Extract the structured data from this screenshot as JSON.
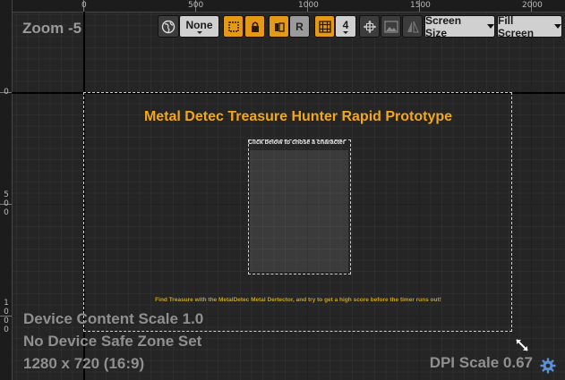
{
  "zoom_label": "Zoom -5",
  "ruler": {
    "top_labels": [
      "0",
      "500",
      "1000",
      "1500",
      "2000"
    ],
    "left_labels": [
      "0",
      "5\n0\n0",
      "1\n0\n0\n0"
    ]
  },
  "toolbar": {
    "globe_icon": "globe-icon",
    "culture_value": "None",
    "lock_icon": "lock-icon",
    "r_label": "R",
    "grid_icon": "grid-icon",
    "snap_value": "4",
    "screen_size_label": "Screen Size",
    "fill_screen_label": "Fill Screen"
  },
  "canvas": {
    "title": "Metal Detec Treasure Hunter Rapid Prototype",
    "panel_label": "Click below to chose a character",
    "hint": "Find Treasure with the MetalDetec Metal Dertector, and try to get a high score before the timer runs out!"
  },
  "info": {
    "content_scale": "Device Content Scale 1.0",
    "safe_zone": "No Device Safe Zone Set",
    "resolution": "1280 x 720 (16:9)",
    "dpi_scale": "DPI Scale 0.67"
  },
  "colors": {
    "accent": "#e49a16",
    "title": "#f2a71a",
    "hint": "#c7a21c"
  }
}
